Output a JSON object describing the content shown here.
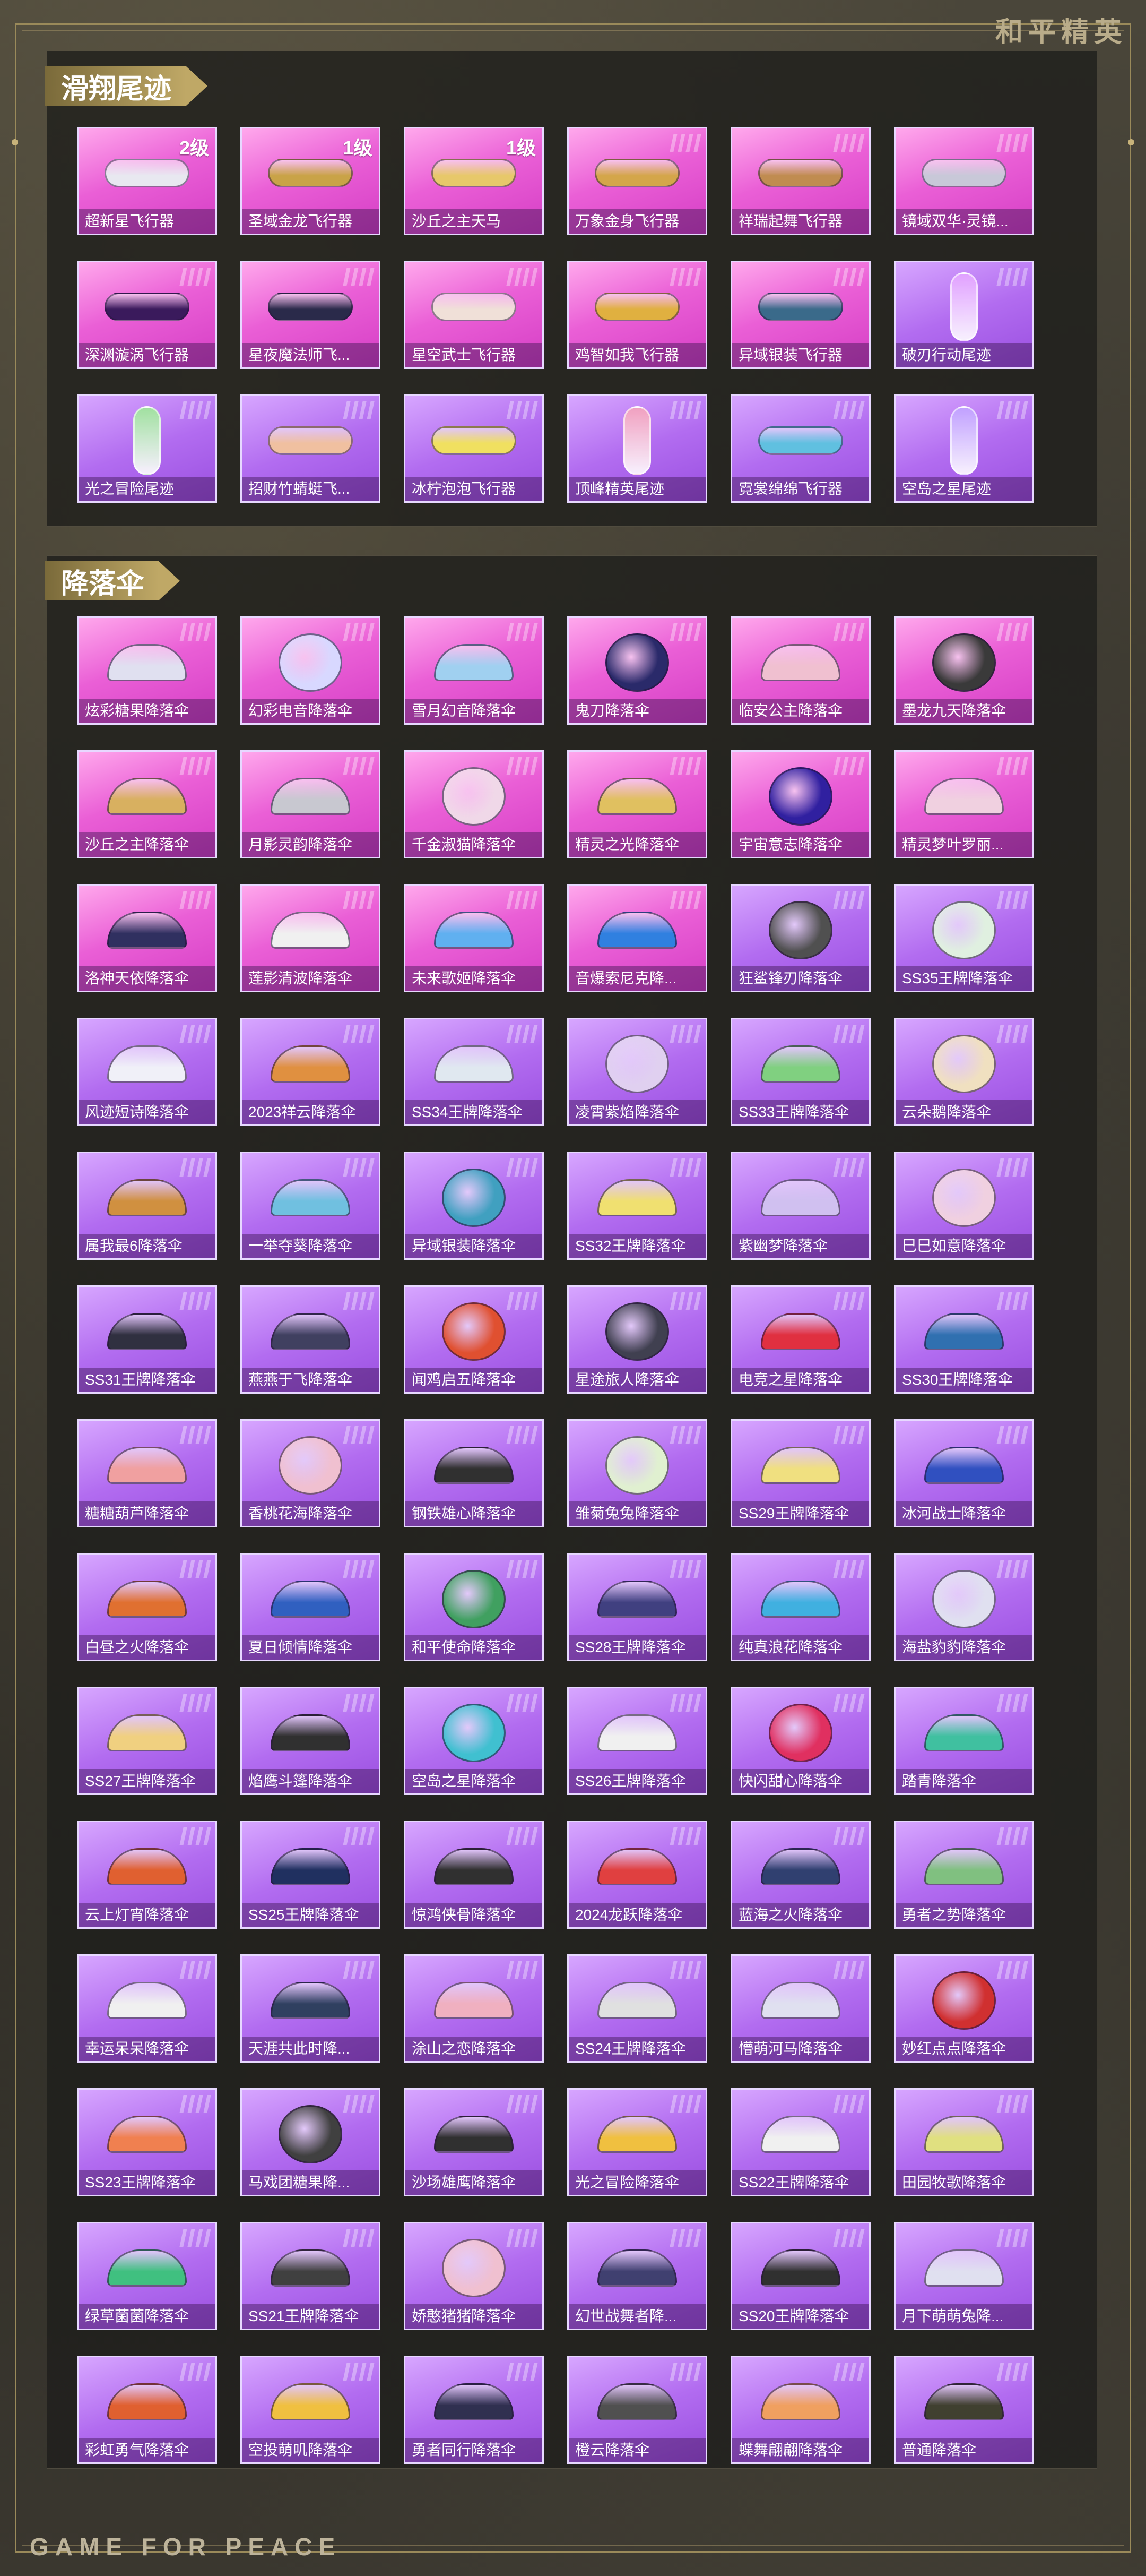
{
  "brand": "和平精英",
  "footer": "GAME FOR PEACE",
  "sections": [
    {
      "title": "滑翔尾迹",
      "items": [
        {
          "label": "超新星飞行器",
          "level": "2级",
          "color": "pink",
          "icon": "glider-icon",
          "tint": "#e8e8f0"
        },
        {
          "label": "圣域金龙飞行器",
          "level": "1级",
          "color": "pink",
          "icon": "dragon-glider-icon",
          "tint": "#c9a347"
        },
        {
          "label": "沙丘之主天马",
          "level": "1级",
          "color": "pink",
          "icon": "pegasus-glider-icon",
          "tint": "#e7c86a"
        },
        {
          "label": "万象金身飞行器",
          "level": "",
          "color": "pink",
          "icon": "glider-icon",
          "tint": "#d4a64a"
        },
        {
          "label": "祥瑞起舞飞行器",
          "level": "",
          "color": "pink",
          "icon": "starfish-glider-icon",
          "tint": "#c08c50"
        },
        {
          "label": "镜域双华·灵镜...",
          "level": "",
          "color": "pink",
          "icon": "glider-icon",
          "tint": "#c8c8d8"
        },
        {
          "label": "深渊漩涡飞行器",
          "level": "",
          "color": "pink",
          "icon": "vortex-glider-icon",
          "tint": "#3a1a5c"
        },
        {
          "label": "星夜魔法师飞...",
          "level": "",
          "color": "pink",
          "icon": "glider-icon",
          "tint": "#2a2a4a"
        },
        {
          "label": "星空武士飞行器",
          "level": "",
          "color": "pink",
          "icon": "glider-icon",
          "tint": "#f0e0d8"
        },
        {
          "label": "鸡智如我飞行器",
          "level": "",
          "color": "pink",
          "icon": "chicken-glider-icon",
          "tint": "#e0b040"
        },
        {
          "label": "异域银装飞行器",
          "level": "",
          "color": "pink",
          "icon": "glider-icon",
          "tint": "#3a6a8a"
        },
        {
          "label": "破刃行动尾迹",
          "level": "",
          "color": "purple",
          "icon": "trail-icon",
          "tint": "#e0a0ff"
        },
        {
          "label": "光之冒险尾迹",
          "level": "",
          "color": "purple",
          "icon": "trail-icon",
          "tint": "#a0e0a0"
        },
        {
          "label": "招财竹蜻蜓飞...",
          "level": "",
          "color": "purple",
          "icon": "propeller-glider-icon",
          "tint": "#f0c0a0"
        },
        {
          "label": "冰柠泡泡飞行器",
          "level": "",
          "color": "purple",
          "icon": "glider-icon",
          "tint": "#f0e060"
        },
        {
          "label": "顶峰精英尾迹",
          "level": "",
          "color": "purple",
          "icon": "trail-icon",
          "tint": "#f0a0c0"
        },
        {
          "label": "霓裳绵绵飞行器",
          "level": "",
          "color": "purple",
          "icon": "glider-icon",
          "tint": "#60c0e0"
        },
        {
          "label": "空岛之星尾迹",
          "level": "",
          "color": "purple",
          "icon": "trail-icon",
          "tint": "#c0a0ff"
        }
      ]
    },
    {
      "title": "降落伞",
      "items": [
        {
          "label": "炫彩糖果降落伞",
          "color": "pink",
          "icon": "parachute-icon",
          "tint": "#e0e0f0"
        },
        {
          "label": "幻彩电音降落伞",
          "color": "pink",
          "icon": "round-parachute-icon",
          "tint": "#d8d8ff"
        },
        {
          "label": "雪月幻音降落伞",
          "color": "pink",
          "icon": "parachute-icon",
          "tint": "#a0d0f0"
        },
        {
          "label": "鬼刀降落伞",
          "color": "pink",
          "icon": "round-parachute-icon",
          "tint": "#2a2a6a"
        },
        {
          "label": "临安公主降落伞",
          "color": "pink",
          "icon": "parachute-icon",
          "tint": "#f0c0d0"
        },
        {
          "label": "墨龙九天降落伞",
          "color": "pink",
          "icon": "round-parachute-icon",
          "tint": "#3a3a3a"
        },
        {
          "label": "沙丘之主降落伞",
          "color": "pink",
          "icon": "parachute-icon",
          "tint": "#d8b060"
        },
        {
          "label": "月影灵韵降落伞",
          "color": "pink",
          "icon": "parachute-icon",
          "tint": "#c8c8d0"
        },
        {
          "label": "千金淑猫降落伞",
          "color": "pink",
          "icon": "round-parachute-icon",
          "tint": "#f0d8e8"
        },
        {
          "label": "精灵之光降落伞",
          "color": "pink",
          "icon": "parachute-icon",
          "tint": "#e0c060"
        },
        {
          "label": "宇宙意志降落伞",
          "color": "pink",
          "icon": "round-parachute-icon",
          "tint": "#3020a0"
        },
        {
          "label": "精灵梦叶罗丽...",
          "color": "pink",
          "icon": "parachute-icon",
          "tint": "#f0d0e0"
        },
        {
          "label": "洛神天依降落伞",
          "color": "pink",
          "icon": "parachute-icon",
          "tint": "#303060"
        },
        {
          "label": "莲影清波降落伞",
          "color": "pink",
          "icon": "parachute-icon",
          "tint": "#f0f0f0"
        },
        {
          "label": "未来歌姬降落伞",
          "color": "pink",
          "icon": "parachute-icon",
          "tint": "#60b0f0"
        },
        {
          "label": "音爆索尼克降...",
          "color": "pink",
          "icon": "parachute-icon",
          "tint": "#3080e0"
        },
        {
          "label": "狂鲨锋刃降落伞",
          "color": "purple",
          "icon": "round-parachute-icon",
          "tint": "#505050"
        },
        {
          "label": "SS35王牌降落伞",
          "color": "purple",
          "icon": "round-parachute-icon",
          "tint": "#e0f0e0"
        },
        {
          "label": "风迹短诗降落伞",
          "color": "purple",
          "icon": "parachute-icon",
          "tint": "#f0f0f8"
        },
        {
          "label": "2023祥云降落伞",
          "color": "purple",
          "icon": "parachute-icon",
          "tint": "#e09040"
        },
        {
          "label": "SS34王牌降落伞",
          "color": "purple",
          "icon": "parachute-icon",
          "tint": "#e0e8f0"
        },
        {
          "label": "凌霄紫焰降落伞",
          "color": "purple",
          "icon": "round-parachute-icon",
          "tint": "#e0d0f0"
        },
        {
          "label": "SS33王牌降落伞",
          "color": "purple",
          "icon": "parachute-icon",
          "tint": "#80d080"
        },
        {
          "label": "云朵鹅降落伞",
          "color": "purple",
          "icon": "round-parachute-icon",
          "tint": "#f0e0c0"
        },
        {
          "label": "属我最6降落伞",
          "color": "purple",
          "icon": "parachute-icon",
          "tint": "#d09040"
        },
        {
          "label": "一举夺葵降落伞",
          "color": "purple",
          "icon": "parachute-icon",
          "tint": "#70c0e0"
        },
        {
          "label": "异域银装降落伞",
          "color": "purple",
          "icon": "round-parachute-icon",
          "tint": "#40a0c0"
        },
        {
          "label": "SS32王牌降落伞",
          "color": "purple",
          "icon": "parachute-icon",
          "tint": "#f0e070"
        },
        {
          "label": "紫幽梦降落伞",
          "color": "purple",
          "icon": "parachute-icon",
          "tint": "#d0c0f0"
        },
        {
          "label": "巳巳如意降落伞",
          "color": "purple",
          "icon": "round-parachute-icon",
          "tint": "#f0d0e0"
        },
        {
          "label": "SS31王牌降落伞",
          "color": "purple",
          "icon": "parachute-icon",
          "tint": "#303040"
        },
        {
          "label": "燕燕于飞降落伞",
          "color": "purple",
          "icon": "parachute-icon",
          "tint": "#404060"
        },
        {
          "label": "闻鸡启五降落伞",
          "color": "purple",
          "icon": "round-parachute-icon",
          "tint": "#e05030"
        },
        {
          "label": "星途旅人降落伞",
          "color": "purple",
          "icon": "round-parachute-icon",
          "tint": "#404050"
        },
        {
          "label": "电竞之星降落伞",
          "color": "purple",
          "icon": "parachute-icon",
          "tint": "#e03040"
        },
        {
          "label": "SS30王牌降落伞",
          "color": "purple",
          "icon": "parachute-icon",
          "tint": "#3070b0"
        },
        {
          "label": "糖糖葫芦降落伞",
          "color": "purple",
          "icon": "parachute-icon",
          "tint": "#f0a0a0"
        },
        {
          "label": "香桃花海降落伞",
          "color": "purple",
          "icon": "round-parachute-icon",
          "tint": "#f0c0d0"
        },
        {
          "label": "钢铁雄心降落伞",
          "color": "purple",
          "icon": "parachute-icon",
          "tint": "#303030"
        },
        {
          "label": "雏菊兔兔降落伞",
          "color": "purple",
          "icon": "round-parachute-icon",
          "tint": "#e0f0d0"
        },
        {
          "label": "SS29王牌降落伞",
          "color": "purple",
          "icon": "parachute-icon",
          "tint": "#f0e080"
        },
        {
          "label": "冰河战士降落伞",
          "color": "purple",
          "icon": "parachute-icon",
          "tint": "#3050c0"
        },
        {
          "label": "白昼之火降落伞",
          "color": "purple",
          "icon": "parachute-icon",
          "tint": "#e07030"
        },
        {
          "label": "夏日倾情降落伞",
          "color": "purple",
          "icon": "parachute-icon",
          "tint": "#3060c0"
        },
        {
          "label": "和平使命降落伞",
          "color": "purple",
          "icon": "round-parachute-icon",
          "tint": "#40a060"
        },
        {
          "label": "SS28王牌降落伞",
          "color": "purple",
          "icon": "parachute-icon",
          "tint": "#404080"
        },
        {
          "label": "纯真浪花降落伞",
          "color": "purple",
          "icon": "parachute-icon",
          "tint": "#40b0e0"
        },
        {
          "label": "海盐豹豹降落伞",
          "color": "purple",
          "icon": "round-parachute-icon",
          "tint": "#e0e0f0"
        },
        {
          "label": "SS27王牌降落伞",
          "color": "purple",
          "icon": "parachute-icon",
          "tint": "#f0d080"
        },
        {
          "label": "焰鹰斗篷降落伞",
          "color": "purple",
          "icon": "parachute-icon",
          "tint": "#303030"
        },
        {
          "label": "空岛之星降落伞",
          "color": "purple",
          "icon": "round-parachute-icon",
          "tint": "#40c0d0"
        },
        {
          "label": "SS26王牌降落伞",
          "color": "purple",
          "icon": "parachute-icon",
          "tint": "#f0f0f0"
        },
        {
          "label": "快闪甜心降落伞",
          "color": "purple",
          "icon": "round-parachute-icon",
          "tint": "#e03060"
        },
        {
          "label": "踏青降落伞",
          "color": "purple",
          "icon": "parachute-icon",
          "tint": "#40c0a0"
        },
        {
          "label": "云上灯宵降落伞",
          "color": "purple",
          "icon": "parachute-icon",
          "tint": "#e06030"
        },
        {
          "label": "SS25王牌降落伞",
          "color": "purple",
          "icon": "parachute-icon",
          "tint": "#203060"
        },
        {
          "label": "惊鸿侠骨降落伞",
          "color": "purple",
          "icon": "parachute-icon",
          "tint": "#303030"
        },
        {
          "label": "2024龙跃降落伞",
          "color": "purple",
          "icon": "parachute-icon",
          "tint": "#e04040"
        },
        {
          "label": "蓝海之火降落伞",
          "color": "purple",
          "icon": "parachute-icon",
          "tint": "#304070"
        },
        {
          "label": "勇者之势降落伞",
          "color": "purple",
          "icon": "parachute-icon",
          "tint": "#80c080"
        },
        {
          "label": "幸运呆呆降落伞",
          "color": "purple",
          "icon": "parachute-icon",
          "tint": "#f0f0f0"
        },
        {
          "label": "天涯共此时降...",
          "color": "purple",
          "icon": "parachute-icon",
          "tint": "#304060"
        },
        {
          "label": "涂山之恋降落伞",
          "color": "purple",
          "icon": "parachute-icon",
          "tint": "#f0b0c0"
        },
        {
          "label": "SS24王牌降落伞",
          "color": "purple",
          "icon": "parachute-icon",
          "tint": "#e0e0e0"
        },
        {
          "label": "懵萌河马降落伞",
          "color": "purple",
          "icon": "parachute-icon",
          "tint": "#e0e0f0"
        },
        {
          "label": "妙红点点降落伞",
          "color": "purple",
          "icon": "round-parachute-icon",
          "tint": "#d03030"
        },
        {
          "label": "SS23王牌降落伞",
          "color": "purple",
          "icon": "parachute-icon",
          "tint": "#f08050"
        },
        {
          "label": "马戏团糖果降...",
          "color": "purple",
          "icon": "round-parachute-icon",
          "tint": "#404040"
        },
        {
          "label": "沙场雄鹰降落伞",
          "color": "purple",
          "icon": "parachute-icon",
          "tint": "#303030"
        },
        {
          "label": "光之冒险降落伞",
          "color": "purple",
          "icon": "parachute-icon",
          "tint": "#f0c040"
        },
        {
          "label": "SS22王牌降落伞",
          "color": "purple",
          "icon": "parachute-icon",
          "tint": "#f0f0f0"
        },
        {
          "label": "田园牧歌降落伞",
          "color": "purple",
          "icon": "parachute-icon",
          "tint": "#e0e080"
        },
        {
          "label": "绿草菌菌降落伞",
          "color": "purple",
          "icon": "parachute-icon",
          "tint": "#40c080"
        },
        {
          "label": "SS21王牌降落伞",
          "color": "purple",
          "icon": "parachute-icon",
          "tint": "#404040"
        },
        {
          "label": "娇憨猪猪降落伞",
          "color": "purple",
          "icon": "round-parachute-icon",
          "tint": "#f0c0d0"
        },
        {
          "label": "幻世战舞者降...",
          "color": "purple",
          "icon": "parachute-icon",
          "tint": "#404070"
        },
        {
          "label": "SS20王牌降落伞",
          "color": "purple",
          "icon": "parachute-icon",
          "tint": "#303030"
        },
        {
          "label": "月下萌萌兔降...",
          "color": "purple",
          "icon": "parachute-icon",
          "tint": "#e0e0f0"
        },
        {
          "label": "彩虹勇气降落伞",
          "color": "purple",
          "icon": "parachute-icon",
          "tint": "#e06030"
        },
        {
          "label": "空投萌叽降落伞",
          "color": "purple",
          "icon": "parachute-icon",
          "tint": "#f0c040"
        },
        {
          "label": "勇者同行降落伞",
          "color": "purple",
          "icon": "parachute-icon",
          "tint": "#303050"
        },
        {
          "label": "橙云降落伞",
          "color": "purple",
          "icon": "parachute-icon",
          "tint": "#505050"
        },
        {
          "label": "蝶舞翩翩降落伞",
          "color": "purple",
          "icon": "parachute-icon",
          "tint": "#f0a060"
        },
        {
          "label": "普通降落伞",
          "color": "purple",
          "icon": "parachute-icon",
          "tint": "#404030"
        }
      ]
    }
  ]
}
